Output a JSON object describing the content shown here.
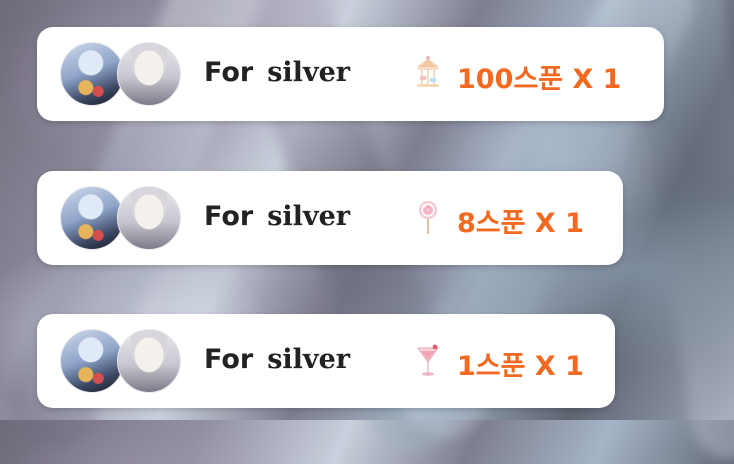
{
  "colors": {
    "card_bg": "#ffffff",
    "sender_text": "#222222",
    "gift_text": "#f26a22"
  },
  "gifts": [
    {
      "sender_prefix": "For",
      "sender_suffix": "silver",
      "gift_icon": "carousel-icon",
      "gift_label": "100스푼 X 1"
    },
    {
      "sender_prefix": "For",
      "sender_suffix": "silver",
      "gift_icon": "lollipop-icon",
      "gift_label": "8스푼 X 1"
    },
    {
      "sender_prefix": "For",
      "sender_suffix": "silver",
      "gift_icon": "cocktail-icon",
      "gift_label": "1스푼 X 1"
    }
  ]
}
